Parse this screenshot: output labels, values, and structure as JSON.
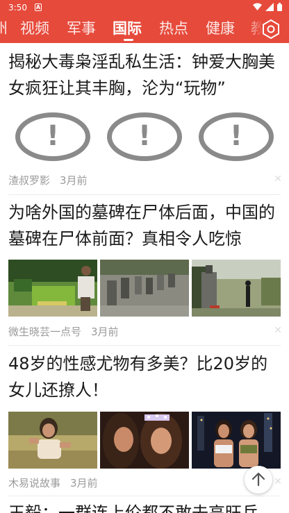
{
  "status_bar": {
    "time": "3:50",
    "notification_icon": "a-icon",
    "icons": [
      "wifi-icon",
      "signal-icon",
      "battery-icon"
    ]
  },
  "tabs": [
    {
      "label": "州",
      "active": false
    },
    {
      "label": "视频",
      "active": false
    },
    {
      "label": "军事",
      "active": false
    },
    {
      "label": "国际",
      "active": true
    },
    {
      "label": "热点",
      "active": false
    },
    {
      "label": "健康",
      "active": false
    },
    {
      "label": "教",
      "active": false
    }
  ],
  "settings_icon": "hexagon-settings-icon",
  "articles": [
    {
      "title": "揭秘大毒枭淫乱私生活：钟爱大胸美女疯狂让其丰胸，沦为“玩物”",
      "source": "渣叔罗影",
      "time": "3月前",
      "images": [
        "image-error-icon",
        "image-error-icon",
        "image-error-icon"
      ]
    },
    {
      "title": "为啥外国的墓碑在尸体后面，中国的墓碑在尸体前面？真相令人吃惊",
      "source": "微生晓芸一点号",
      "time": "3月前",
      "images": [
        "man-at-grave-photo",
        "cemetery-rows-photo",
        "memorial-stone-photo"
      ]
    },
    {
      "title": "48岁的性感尤物有多美？比20岁的女儿还撩人！",
      "source": "木易说故事",
      "time": "3月前",
      "images": [
        "woman-on-grass-photo",
        "two-women-selfie-photo",
        "two-women-city-night-photo"
      ]
    },
    {
      "title": "王毅：一群连上伦都不敢去高旺兵",
      "source": "",
      "time": "",
      "images": []
    }
  ],
  "dismiss_icon": "close-icon",
  "back_to_top_icon": "arrow-up-icon",
  "colors": {
    "brand_red": "#e64a3b",
    "meta_gray": "#9a9a9a",
    "title_black": "#1a1a1a"
  }
}
